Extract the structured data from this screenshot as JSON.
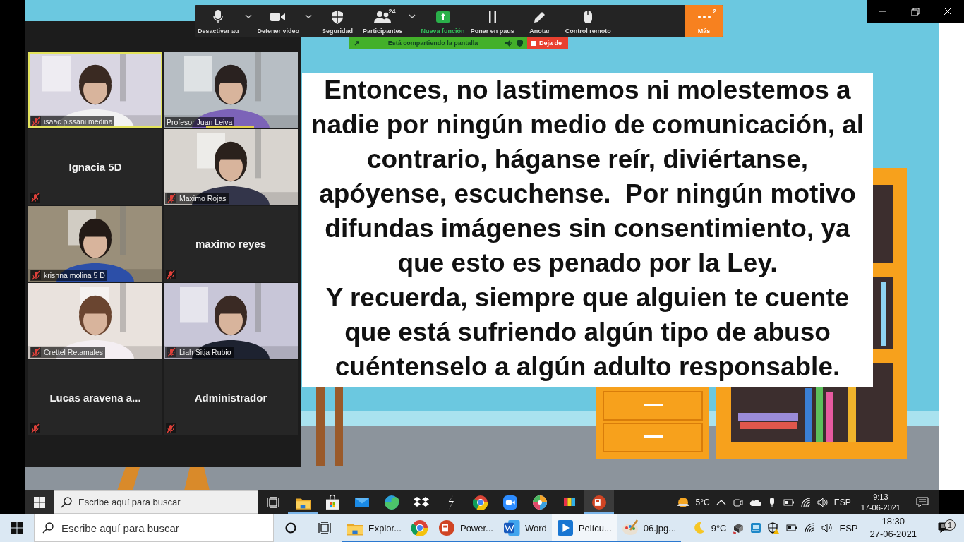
{
  "meeting_toolbar": {
    "buttons": [
      {
        "kind": "microphone",
        "label": "Desactivar au",
        "caret": true
      },
      {
        "kind": "camera",
        "label": "Detener video",
        "caret": true
      },
      {
        "kind": "security",
        "label": "Seguridad",
        "caret": false
      },
      {
        "kind": "participants",
        "label": "Participantes",
        "count": "24",
        "caret": true
      },
      {
        "kind": "share",
        "label": "Nueva función",
        "caret": false
      },
      {
        "kind": "pause",
        "label": "Poner en paus",
        "caret": false
      },
      {
        "kind": "annotate",
        "label": "Anotar",
        "caret": false
      },
      {
        "kind": "remote",
        "label": "Control remoto",
        "caret": false
      },
      {
        "kind": "more",
        "label": "Más",
        "count": "2",
        "caret": false
      }
    ]
  },
  "share_banner": {
    "status": "Está compartiendo la pantalla",
    "stop": "Deja de"
  },
  "gallery": {
    "tiles": [
      {
        "kind": "video",
        "name": "isaac pissani medina",
        "muted": true,
        "selected": true,
        "speaking": false
      },
      {
        "kind": "video",
        "name": "Profesor Juan Leiva",
        "muted": false,
        "selected": false,
        "speaking": true
      },
      {
        "kind": "name",
        "name": "Ignacia 5D",
        "muted": true,
        "selected": false,
        "speaking": false
      },
      {
        "kind": "video",
        "name": "Maximo Rojas",
        "muted": true,
        "selected": false,
        "speaking": false
      },
      {
        "kind": "video",
        "name": "krishna molina 5 D",
        "muted": true,
        "selected": false,
        "speaking": false
      },
      {
        "kind": "name",
        "name": "maximo reyes",
        "muted": true,
        "selected": false,
        "speaking": false
      },
      {
        "kind": "video",
        "name": "Crettel Retamales",
        "muted": true,
        "selected": false,
        "speaking": false
      },
      {
        "kind": "video",
        "name": "Liah Sitja Rubio",
        "muted": true,
        "selected": false,
        "speaking": false
      },
      {
        "kind": "name",
        "name": "Lucas aravena a...",
        "muted": true,
        "selected": false,
        "speaking": false
      },
      {
        "kind": "name",
        "name": "Administrador",
        "muted": true,
        "selected": false,
        "speaking": false
      }
    ]
  },
  "slide": {
    "paragraphs": [
      "Entonces, no lastimemos ni molestemos a nadie por ningún medio de comunicación, al contrario, háganse reír, diviértanse, apóyense, escuchense.  Por ningún motivo difundas imágenes sin consentimiento, ya que esto es penado por la Ley.",
      "Y recuerda, siempre que alguien te cuente que está sufriendo algún tipo de abuso cuéntenselo a algún adulto responsable."
    ]
  },
  "shared_taskbar": {
    "search": {
      "placeholder": "Escribe aquí para buscar"
    },
    "apps": [
      {
        "kind": "folder",
        "running": true,
        "selected": false
      },
      {
        "kind": "store",
        "running": false,
        "selected": false
      },
      {
        "kind": "mail",
        "running": false,
        "selected": false
      },
      {
        "kind": "edge",
        "running": false,
        "selected": false
      },
      {
        "kind": "dropbox",
        "running": false,
        "selected": false
      },
      {
        "kind": "stylus",
        "running": false,
        "selected": false
      },
      {
        "kind": "chrome",
        "running": false,
        "selected": false
      },
      {
        "kind": "zoom",
        "running": false,
        "selected": false
      },
      {
        "kind": "pinwheel",
        "running": false,
        "selected": false
      },
      {
        "kind": "tv",
        "running": false,
        "selected": false
      },
      {
        "kind": "powerpoint",
        "running": true,
        "selected": true
      }
    ],
    "tray": {
      "temperature": "5°C",
      "language": "ESP",
      "time": "9:13",
      "date": "17-06-2021"
    }
  },
  "taskbar": {
    "search": {
      "placeholder": "Escribe aquí para buscar"
    },
    "apps": [
      {
        "kind": "folder",
        "label": "Explor...",
        "running": true,
        "selected": false
      },
      {
        "kind": "chrome",
        "running": true,
        "selected": false
      },
      {
        "kind": "powerpoint",
        "label": "Power...",
        "running": true,
        "selected": false
      },
      {
        "kind": "word",
        "label": "Word",
        "running": true,
        "selected": false
      },
      {
        "kind": "movies",
        "label": "Pelícu...",
        "running": true,
        "selected": true
      },
      {
        "kind": "paint",
        "label": "06.jpg...",
        "running": true,
        "selected": false
      }
    ],
    "tray": {
      "temperature": "9°C",
      "language": "ESP",
      "time": "18:30",
      "date": "27-06-2021",
      "notifications": "1"
    }
  }
}
